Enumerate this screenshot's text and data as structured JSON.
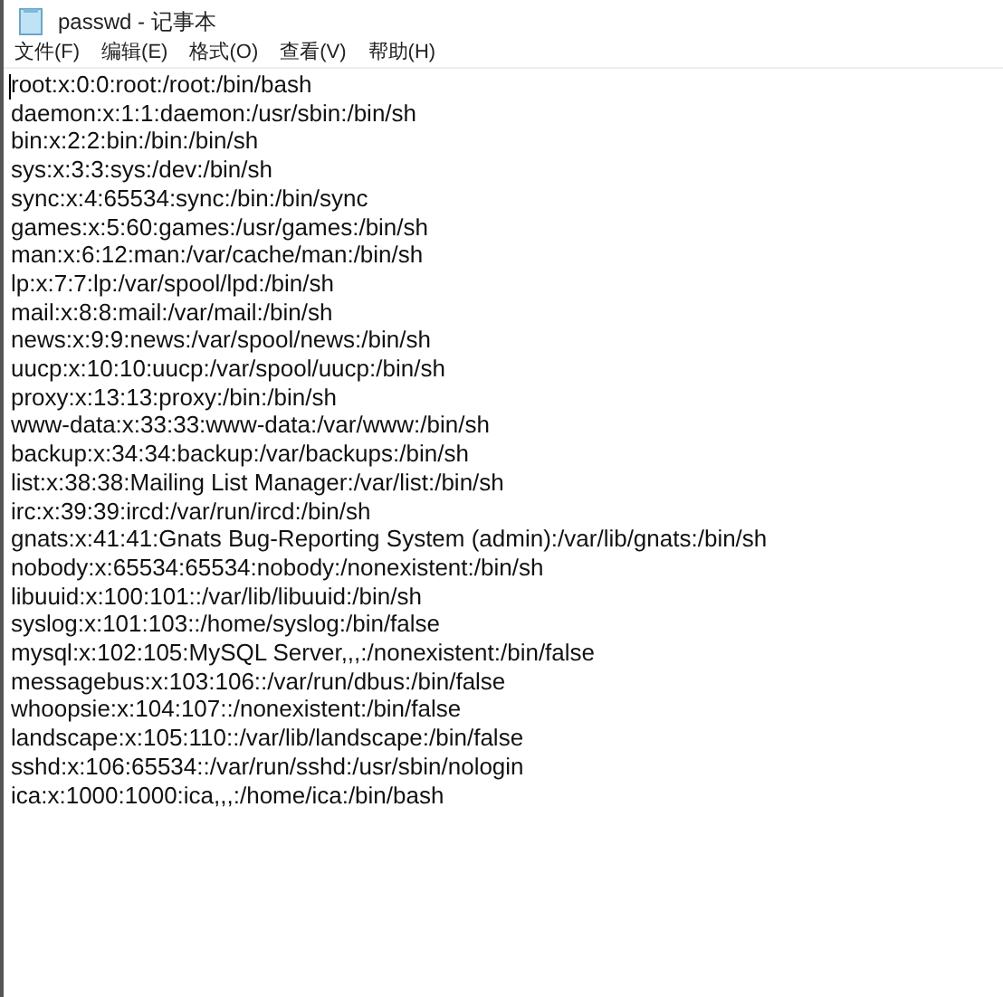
{
  "window": {
    "title": "passwd - 记事本"
  },
  "menu": [
    "文件(F)",
    "编辑(E)",
    "格式(O)",
    "查看(V)",
    "帮助(H)"
  ],
  "editor": {
    "lines": [
      "root:x:0:0:root:/root:/bin/bash",
      "daemon:x:1:1:daemon:/usr/sbin:/bin/sh",
      "bin:x:2:2:bin:/bin:/bin/sh",
      "sys:x:3:3:sys:/dev:/bin/sh",
      "sync:x:4:65534:sync:/bin:/bin/sync",
      "games:x:5:60:games:/usr/games:/bin/sh",
      "man:x:6:12:man:/var/cache/man:/bin/sh",
      "lp:x:7:7:lp:/var/spool/lpd:/bin/sh",
      "mail:x:8:8:mail:/var/mail:/bin/sh",
      "news:x:9:9:news:/var/spool/news:/bin/sh",
      "uucp:x:10:10:uucp:/var/spool/uucp:/bin/sh",
      "proxy:x:13:13:proxy:/bin:/bin/sh",
      "www-data:x:33:33:www-data:/var/www:/bin/sh",
      "backup:x:34:34:backup:/var/backups:/bin/sh",
      "list:x:38:38:Mailing List Manager:/var/list:/bin/sh",
      "irc:x:39:39:ircd:/var/run/ircd:/bin/sh",
      "gnats:x:41:41:Gnats Bug-Reporting System (admin):/var/lib/gnats:/bin/sh",
      "nobody:x:65534:65534:nobody:/nonexistent:/bin/sh",
      "libuuid:x:100:101::/var/lib/libuuid:/bin/sh",
      "syslog:x:101:103::/home/syslog:/bin/false",
      "mysql:x:102:105:MySQL Server,,,:/nonexistent:/bin/false",
      "messagebus:x:103:106::/var/run/dbus:/bin/false",
      "whoopsie:x:104:107::/nonexistent:/bin/false",
      "landscape:x:105:110::/var/lib/landscape:/bin/false",
      "sshd:x:106:65534::/var/run/sshd:/usr/sbin/nologin",
      "ica:x:1000:1000:ica,,,:/home/ica:/bin/bash"
    ]
  }
}
